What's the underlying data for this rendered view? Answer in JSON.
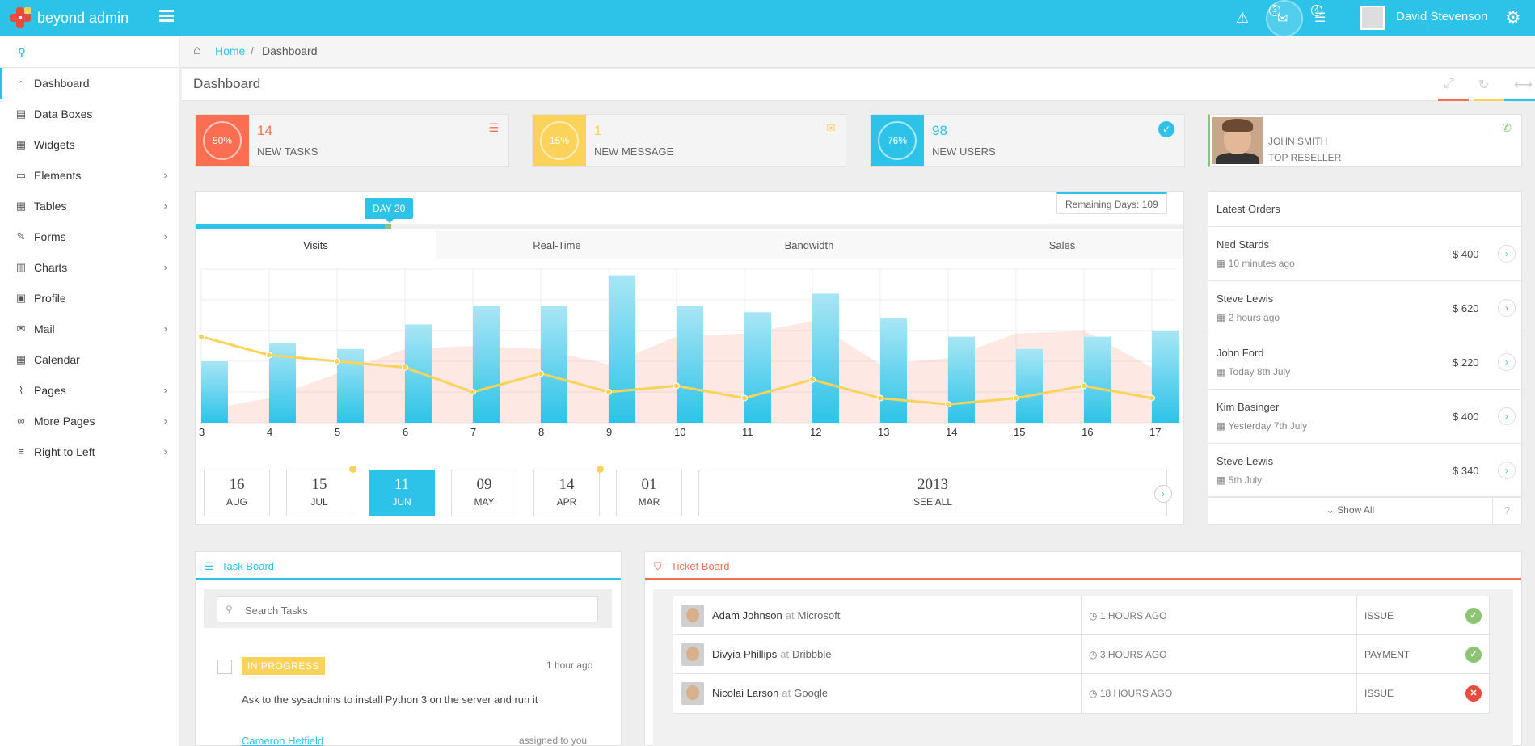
{
  "app": {
    "name": "beyond admin",
    "user": "David Stevenson"
  },
  "topbar": {
    "messages_count": "3",
    "tasks_count": "4"
  },
  "sidebar": {
    "items": [
      {
        "label": "Dashboard",
        "icon": "home-icon"
      },
      {
        "label": "Data Boxes",
        "icon": "databox-icon"
      },
      {
        "label": "Widgets",
        "icon": "widgets-icon"
      },
      {
        "label": "Elements",
        "icon": "desktop-icon"
      },
      {
        "label": "Tables",
        "icon": "table-icon"
      },
      {
        "label": "Forms",
        "icon": "edit-icon"
      },
      {
        "label": "Charts",
        "icon": "bar-chart-icon"
      },
      {
        "label": "Profile",
        "icon": "picture-icon"
      },
      {
        "label": "Mail",
        "icon": "envelope-icon"
      },
      {
        "label": "Calendar",
        "icon": "calendar-icon"
      },
      {
        "label": "Pages",
        "icon": "paperclip-icon"
      },
      {
        "label": "More Pages",
        "icon": "link-icon"
      },
      {
        "label": "Right to Left",
        "icon": "align-right-icon"
      }
    ]
  },
  "breadcrumb": {
    "home": "Home",
    "separator": "/",
    "current": "Dashboard"
  },
  "page": {
    "title": "Dashboard"
  },
  "stats": [
    {
      "percent": "50%",
      "value": "14",
      "label": "NEW TASKS",
      "color": "#fb6e52"
    },
    {
      "percent": "15%",
      "value": "1",
      "label": "NEW MESSAGE",
      "color": "#fbd25a"
    },
    {
      "percent": "76%",
      "value": "98",
      "label": "NEW USERS",
      "color": "#2dc3e8"
    }
  ],
  "reseller": {
    "name": "JOHN SMITH",
    "role": "TOP RESELLER"
  },
  "chart_widget": {
    "day_tag": "DAY 20",
    "remaining": "Remaining Days: 109",
    "progress": 0.195,
    "tabs": [
      "Visits",
      "Real-Time",
      "Bandwidth",
      "Sales"
    ],
    "dates": [
      {
        "day": "16",
        "month": "AUG",
        "dot": false,
        "active": false
      },
      {
        "day": "15",
        "month": "JUL",
        "dot": true,
        "active": false
      },
      {
        "day": "11",
        "month": "JUN",
        "dot": false,
        "active": true
      },
      {
        "day": "09",
        "month": "MAY",
        "dot": false,
        "active": false
      },
      {
        "day": "14",
        "month": "APR",
        "dot": true,
        "active": false
      },
      {
        "day": "01",
        "month": "MAR",
        "dot": false,
        "active": false
      }
    ],
    "year": {
      "value": "2013",
      "label": "SEE ALL"
    }
  },
  "chart_data": {
    "type": "bar",
    "categories": [
      "3",
      "4",
      "5",
      "6",
      "7",
      "8",
      "9",
      "10",
      "11",
      "12",
      "13",
      "14",
      "15",
      "16",
      "17"
    ],
    "ylim": [
      0,
      250
    ],
    "series": [
      {
        "type": "area",
        "values": [
          20,
          40,
          80,
          120,
          125,
          120,
          95,
          140,
          145,
          165,
          95,
          105,
          145,
          150,
          90
        ],
        "color": "#fb6e52"
      },
      {
        "type": "bar",
        "values": [
          100,
          130,
          120,
          160,
          190,
          190,
          240,
          190,
          180,
          210,
          170,
          140,
          120,
          140,
          150
        ],
        "color": "#2dc3e8"
      },
      {
        "type": "line",
        "values": [
          140,
          110,
          100,
          90,
          50,
          80,
          50,
          60,
          40,
          70,
          40,
          30,
          40,
          60,
          40
        ],
        "color": "#fbd25a"
      }
    ]
  },
  "orders": {
    "title": "Latest Orders",
    "items": [
      {
        "name": "Ned Stards",
        "time": "10 minutes ago",
        "amount": "$ 400",
        "color": "#2dc3e8"
      },
      {
        "name": "Steve Lewis",
        "time": "2 hours ago",
        "amount": "$ 620",
        "color": "#fb6e52"
      },
      {
        "name": "John Ford",
        "time": "Today 8th July",
        "amount": "$ 220",
        "color": "#2dc3e8"
      },
      {
        "name": "Kim Basinger",
        "time": "Yesterday 7th July",
        "amount": "$ 400",
        "color": "#2dc3e8"
      },
      {
        "name": "Steve Lewis",
        "time": "5th July",
        "amount": "$ 340",
        "color": "#2dc3e8"
      }
    ],
    "show_all": "Show All"
  },
  "taskboard": {
    "title": "Task Board",
    "search_placeholder": "Search Tasks",
    "task": {
      "status": "IN PROGRESS",
      "time": "1 hour ago",
      "text": "Ask to the sysadmins to install Python 3 on the server and run it",
      "user": "Cameron Hetfield",
      "assigned": "assigned to you"
    }
  },
  "ticketboard": {
    "title": "Ticket Board",
    "tickets": [
      {
        "name": "Adam Johnson",
        "at": "at",
        "company": "Microsoft",
        "time": "1 HOURS AGO",
        "type": "ISSUE",
        "status_color": "#8cc474",
        "status_glyph": "✓"
      },
      {
        "name": "Divyia Phillips",
        "at": "at",
        "company": "Dribbble",
        "time": "3 HOURS AGO",
        "type": "PAYMENT",
        "status_color": "#8cc474",
        "status_glyph": "✓"
      },
      {
        "name": "Nicolai Larson",
        "at": "at",
        "company": "Google",
        "time": "18 HOURS AGO",
        "type": "ISSUE",
        "status_color": "#e74c3c",
        "status_glyph": "✕"
      }
    ]
  }
}
